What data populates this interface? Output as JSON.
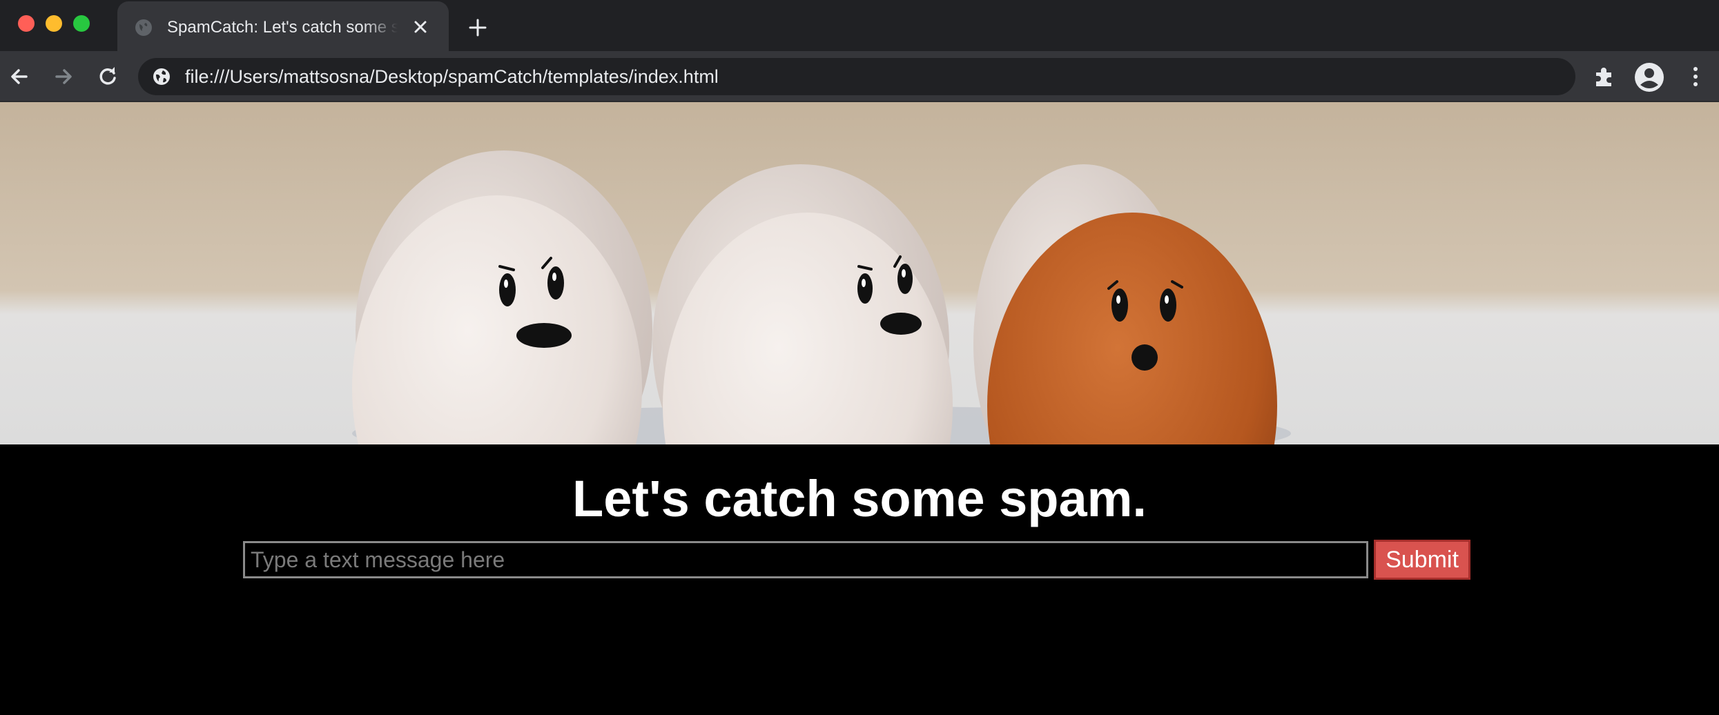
{
  "browser": {
    "tab": {
      "title": "SpamCatch: Let's catch some spam."
    },
    "address_bar": {
      "url": "file:///Users/mattsosna/Desktop/spamCatch/templates/index.html"
    }
  },
  "page": {
    "heading": "Let's catch some spam.",
    "form": {
      "message_placeholder": "Type a text message here",
      "message_value": "",
      "submit_label": "Submit"
    }
  },
  "colors": {
    "page_background": "#000000",
    "submit_button": "#d9534f",
    "chrome_dark": "#202124",
    "chrome_toolbar": "#35363a"
  },
  "icons": [
    "globe-icon",
    "close-icon",
    "plus-icon",
    "back-arrow-icon",
    "forward-arrow-icon",
    "reload-icon",
    "site-info-icon",
    "puzzle-extension-icon",
    "profile-icon",
    "kebab-menu-icon"
  ]
}
